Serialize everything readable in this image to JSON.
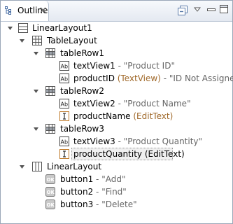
{
  "view": {
    "title": "Outline",
    "toolbar": {
      "icons": [
        "collapse-all-icon",
        "view-menu-icon",
        "minimize-icon",
        "maximize-icon"
      ]
    }
  },
  "tree": {
    "root": {
      "label": "LinearLayout1"
    },
    "tableLayout": {
      "label": "TableLayout"
    },
    "tableRow1": {
      "label": "tableRow1"
    },
    "textView1": {
      "name": "textView1",
      "sep": " - ",
      "value": "\"Product ID\""
    },
    "productID": {
      "name": "productID",
      "type": " (TextView)",
      "sep": " - ",
      "value": "\"ID Not Assigned\""
    },
    "tableRow2": {
      "label": "tableRow2"
    },
    "textView2": {
      "name": "textView2",
      "sep": " - ",
      "value": "\"Product Name\""
    },
    "productName": {
      "name": "productName",
      "type": " (EditText)"
    },
    "tableRow3": {
      "label": "tableRow3"
    },
    "textView3": {
      "name": "textView3",
      "sep": " - ",
      "value": "\"Product Quantity\""
    },
    "productQuantity": {
      "name": "productQuantity",
      "type": " (EditText)"
    },
    "linearLayout": {
      "label": "LinearLayout"
    },
    "button1": {
      "name": "button1",
      "sep": " - ",
      "value": "\"Add\""
    },
    "button2": {
      "name": "button2",
      "sep": " - ",
      "value": "\"Find\""
    },
    "button3": {
      "name": "button3",
      "sep": " - ",
      "value": "\"Delete\""
    }
  },
  "colors": {
    "frame": "#9aa7b8",
    "type_label": "#a0692a",
    "value_text": "#666666"
  }
}
